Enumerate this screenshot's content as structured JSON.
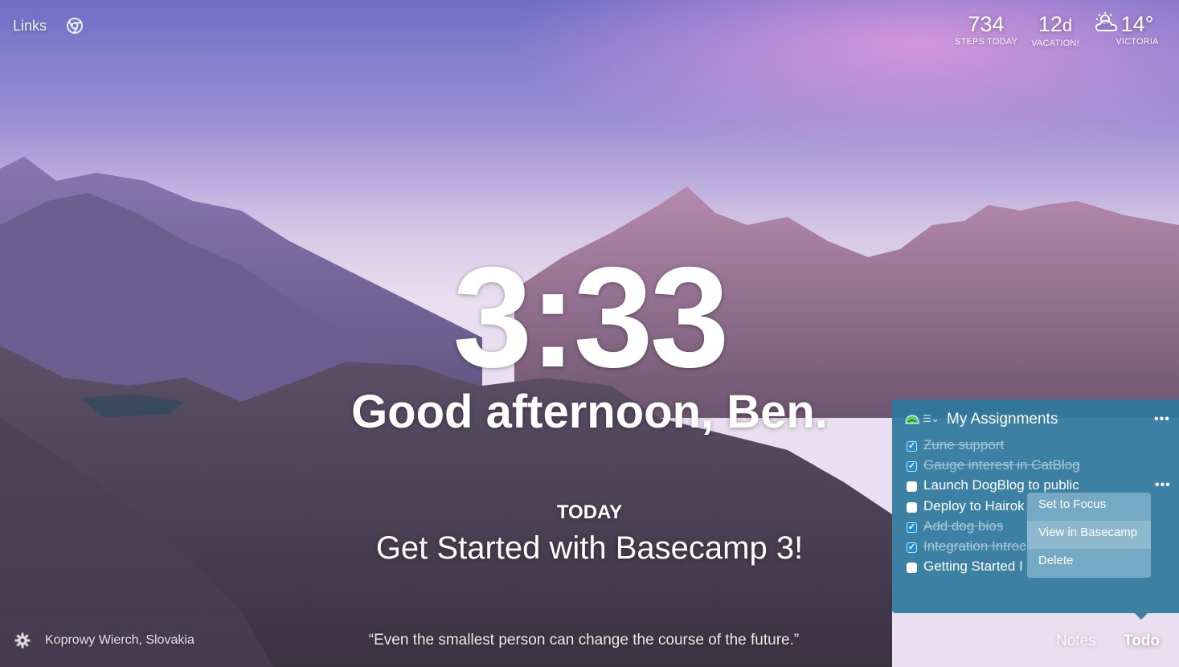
{
  "top_left": {
    "links_label": "Links",
    "chrome_icon": "chrome-icon"
  },
  "metrics": [
    {
      "value": "734",
      "unit": "",
      "label": "STEPS TODAY"
    },
    {
      "value": "12",
      "unit": "d",
      "label": "VACATION!"
    },
    {
      "value": "14°",
      "unit": "",
      "label": "VICTORIA",
      "icon": "partly-cloudy-icon"
    }
  ],
  "clock": "3:33",
  "greeting": "Good afternoon, Ben.",
  "focus": {
    "label": "TODAY",
    "text": "Get Started with Basecamp 3!"
  },
  "bottom": {
    "settings_icon": "gear-icon",
    "location": "Koprowy Wierch, Slovakia",
    "quote": "“Even the smallest person can change the course of the future.”",
    "notes_label": "Notes",
    "todo_label": "Todo"
  },
  "todo_panel": {
    "list_title": "My Assignments",
    "items": [
      {
        "text": "Zune support",
        "done": true
      },
      {
        "text": "Gauge interest in CatBlog",
        "done": true
      },
      {
        "text": "Launch DogBlog to public",
        "done": false
      },
      {
        "text": "Deploy to Hairok",
        "done": false
      },
      {
        "text": "Add dog bios",
        "done": true
      },
      {
        "text": "Integration Introc",
        "done": true
      },
      {
        "text": "Getting Started I",
        "done": false
      }
    ],
    "context_menu": [
      "Set to Focus",
      "View in Basecamp",
      "Delete"
    ],
    "context_menu_active": "View in Basecamp"
  },
  "colors": {
    "panel": "#2e789e",
    "sky_top": "#6e6fc4",
    "sky_pink": "#d68fd6"
  }
}
